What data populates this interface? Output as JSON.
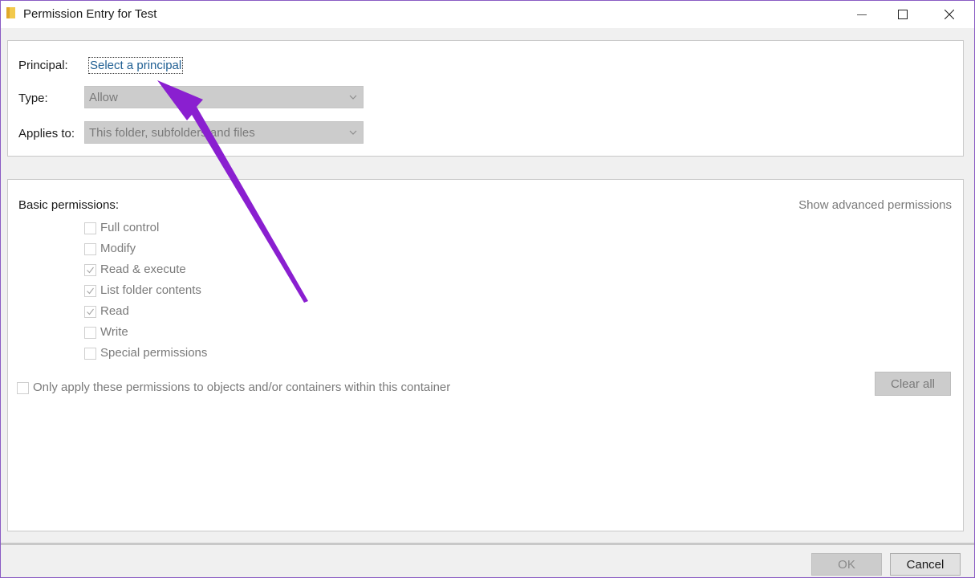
{
  "window": {
    "title": "Permission Entry for Test",
    "controls": {
      "minimize": "minimize",
      "maximize": "maximize",
      "close": "close"
    }
  },
  "principal": {
    "label": "Principal:",
    "link_text": "Select a principal"
  },
  "type": {
    "label": "Type:",
    "value": "Allow"
  },
  "applies_to": {
    "label": "Applies to:",
    "value": "This folder, subfolders and files"
  },
  "permissions": {
    "heading": "Basic permissions:",
    "advanced_link": "Show advanced permissions",
    "items": [
      {
        "label": "Full control",
        "checked": false
      },
      {
        "label": "Modify",
        "checked": false
      },
      {
        "label": "Read & execute",
        "checked": true
      },
      {
        "label": "List folder contents",
        "checked": true
      },
      {
        "label": "Read",
        "checked": true
      },
      {
        "label": "Write",
        "checked": false
      },
      {
        "label": "Special permissions",
        "checked": false
      }
    ],
    "only_apply_label": "Only apply these permissions to objects and/or containers within this container",
    "clear_all": "Clear all"
  },
  "footer": {
    "ok": "OK",
    "cancel": "Cancel"
  },
  "colors": {
    "annotation_arrow": "#8a1fd0",
    "link": "#1f5f93",
    "window_border": "#8a5cc4"
  },
  "icons": [
    "folder-icon",
    "minimize-icon",
    "maximize-icon",
    "close-icon",
    "chevron-down-icon",
    "checkmark-icon",
    "annotation-arrow"
  ]
}
